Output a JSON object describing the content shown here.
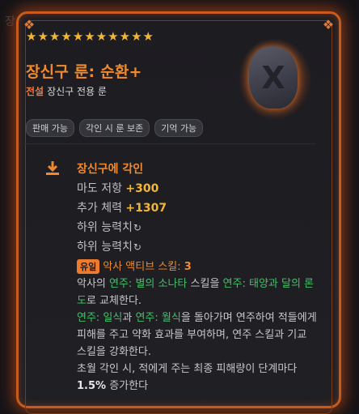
{
  "background_char": "장",
  "item": {
    "stars_count": 11,
    "title": "장신구 룬: 순환+",
    "rarity": "전설",
    "subtitle": "장신구 전용 룬",
    "tags": [
      "판매 가능",
      "각인 시 룬 보존",
      "기억 가능"
    ],
    "rune_glyph": "X"
  },
  "engrave": {
    "title": "장신구에 각인",
    "stats": [
      {
        "label": "마도 저항 ",
        "value": "+300"
      },
      {
        "label": "추가 체력 ",
        "value": "+1307"
      }
    ],
    "sub_stats": [
      "하위 능력치",
      "하위 능력치"
    ],
    "reroll_symbol": "↻",
    "skill_badge": "유일",
    "skill_text": "악사 액티브 스킬: ",
    "skill_level": "3",
    "desc1": {
      "a": "악사의 ",
      "b": "연주: 별의 소나타",
      "c": " 스킬을 ",
      "d": "연주: 태양과 달의 론도",
      "e": "로 교체한다."
    },
    "desc2": {
      "a": "연주: 일식",
      "b": "과 ",
      "c": "연주: 월식",
      "d": "을 돌아가며 연주하여 적들에게 피해를 주고 약화 효과를 부여하며, 연주 스킬과 기교 스킬을 강화한다."
    },
    "desc3": {
      "a": "초월 각인 시, 적에게 주는 최종 피해량이 단계마다 ",
      "b": "1.5%",
      "c": " 증가한다"
    }
  },
  "colors": {
    "accent": "#f08a2c",
    "star": "#f3b634",
    "skill_green": "#44c06a",
    "frame": "#c95a1d"
  }
}
